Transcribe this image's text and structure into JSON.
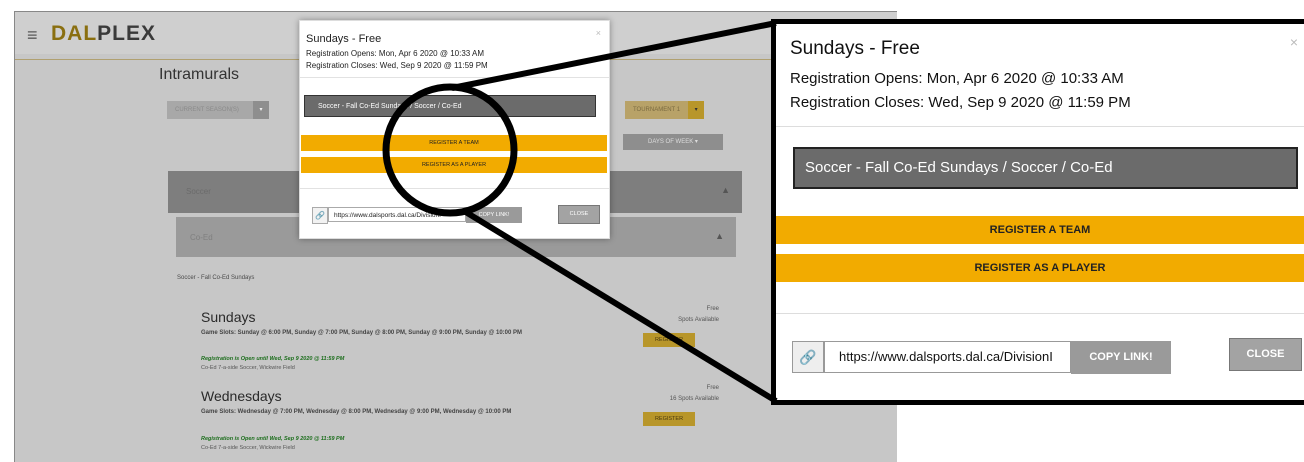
{
  "background": {
    "logo": {
      "part1": "DAL",
      "part2": "PLEX"
    },
    "page_title": "Intramurals",
    "tab_current_season": "CURRENT SEASON(S)",
    "tab_right": "TOURNAMENT 1",
    "days_of_week": "DAYS OF WEEK",
    "accordion_sport": "Soccer",
    "accordion_division": "Co-Ed",
    "breadcrumb": "Soccer - Fall Co-Ed Sundays",
    "events": [
      {
        "title": "Sundays",
        "slots": "Game Slots: Sunday @ 6:00 PM, Sunday @ 7:00 PM, Sunday @ 8:00 PM, Sunday @ 9:00 PM, Sunday @ 10:00 PM",
        "open": "Registration is Open until Wed, Sep 9 2020 @ 11:59 PM",
        "location": "Co-Ed 7-a-side Soccer, Wickwire Field",
        "price": "Free",
        "spots": "Spots Available",
        "button": "REGISTER"
      },
      {
        "title": "Wednesdays",
        "slots": "Game Slots: Wednesday @ 7:00 PM, Wednesday @ 8:00 PM, Wednesday @ 9:00 PM, Wednesday @ 10:00 PM",
        "open": "Registration is Open until Wed, Sep 9 2020 @ 11:59 PM",
        "location": "Co-Ed 7-a-side Soccer, Wickwire Field",
        "price": "Free",
        "spots": "16 Spots Available",
        "button": "REGISTER"
      }
    ]
  },
  "modal": {
    "title": "Sundays - Free",
    "opens": "Registration Opens: Mon, Apr 6 2020 @ 10:33 AM",
    "closes": "Registration Closes: Wed, Sep 9 2020 @ 11:59 PM",
    "division": "Soccer - Fall Co-Ed Sundays  /  Soccer  /  Co-Ed",
    "register_team": "REGISTER A TEAM",
    "register_player": "REGISTER AS A PLAYER",
    "url": "https://www.dalsports.dal.ca/DivisionI",
    "copy_link": "COPY LINK!",
    "close": "CLOSE",
    "close_x": "×",
    "link_icon": "🔗"
  },
  "colors": {
    "accent": "#f2ab00",
    "division_bg": "#6b6b6b",
    "button_gray": "#9a9a9a"
  }
}
